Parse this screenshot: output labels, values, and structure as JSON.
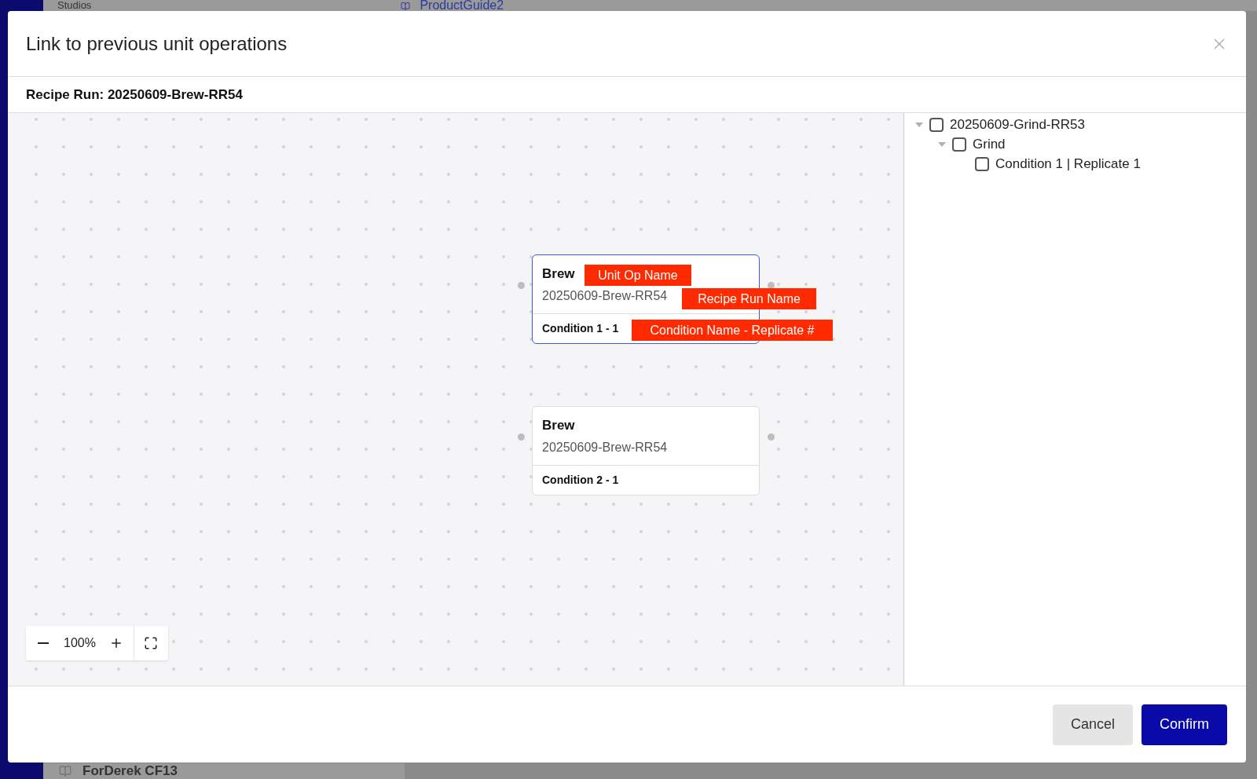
{
  "background": {
    "studios_tab": "Studios",
    "document_tab": "ProductGuide2",
    "list_item": "ForDerek CF13"
  },
  "dialog": {
    "title": "Link to previous unit operations",
    "recipe_run": "Recipe Run: 20250609-Brew-RR54",
    "nodes": [
      {
        "title": "Brew",
        "recipe_run": "20250609-Brew-RR54",
        "condition": "Condition 1 - 1",
        "selected": true
      },
      {
        "title": "Brew",
        "recipe_run": "20250609-Brew-RR54",
        "condition": "Condition 2 - 1",
        "selected": false
      }
    ],
    "annotations": [
      "Unit Op Name",
      "Recipe Run Name",
      "Condition Name - Replicate #"
    ],
    "zoom": "100%",
    "tree": [
      {
        "label": "20250609-Grind-RR53",
        "checked": false,
        "expanded": true,
        "children": [
          {
            "label": "Grind",
            "checked": false,
            "expanded": true,
            "children": [
              {
                "label": "Condition 1 | Replicate 1",
                "checked": false
              }
            ]
          }
        ]
      }
    ],
    "buttons": {
      "cancel": "Cancel",
      "confirm": "Confirm"
    }
  }
}
